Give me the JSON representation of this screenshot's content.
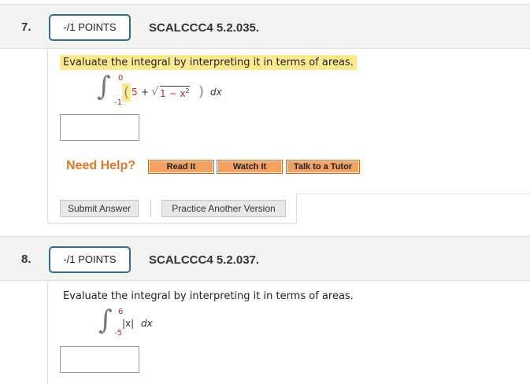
{
  "questions": [
    {
      "number": "7.",
      "points": "-/1 POINTS",
      "code": "SCALCCC4 5.2.035.",
      "prompt": "Evaluate the integral by interpreting it in terms of areas.",
      "integral": {
        "upper": "0",
        "lower": "-1",
        "const": "5",
        "plus": "+",
        "radicand": "1 − x",
        "exp": "2",
        "dx": "dx"
      },
      "answer_value": "",
      "need_help_label": "Need Help?",
      "help_buttons": [
        "Read It",
        "Watch It",
        "Talk to a Tutor"
      ],
      "submit_label": "Submit Answer",
      "practice_label": "Practice Another Version"
    },
    {
      "number": "8.",
      "points": "-/1 POINTS",
      "code": "SCALCCC4 5.2.037.",
      "prompt": "Evaluate the integral by interpreting it in terms of areas.",
      "integral": {
        "upper": "6",
        "lower": "-5",
        "integrand": "|x|",
        "dx": "dx"
      },
      "answer_value": ""
    }
  ],
  "colors": {
    "highlight": "#fde98e",
    "help_text": "#e07828",
    "help_button": "#f4a060",
    "points_border": "#2f6f8a",
    "limit_red": "#c0282c"
  }
}
